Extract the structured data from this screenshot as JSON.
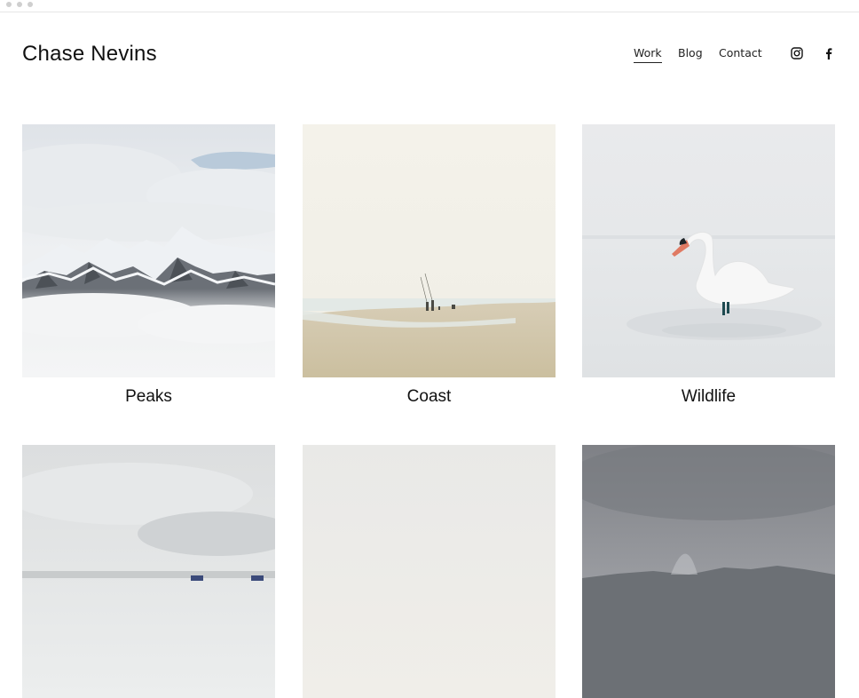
{
  "site": {
    "title": "Chase Nevins"
  },
  "nav": {
    "items": [
      {
        "label": "Work",
        "active": true
      },
      {
        "label": "Blog",
        "active": false
      },
      {
        "label": "Contact",
        "active": false
      }
    ],
    "social": [
      "instagram-icon",
      "facebook-icon"
    ]
  },
  "gallery": {
    "items": [
      {
        "title": "Peaks"
      },
      {
        "title": "Coast"
      },
      {
        "title": "Wildlife"
      },
      {
        "title": ""
      },
      {
        "title": ""
      },
      {
        "title": ""
      }
    ]
  },
  "colors": {
    "text": "#111111",
    "background": "#ffffff"
  }
}
